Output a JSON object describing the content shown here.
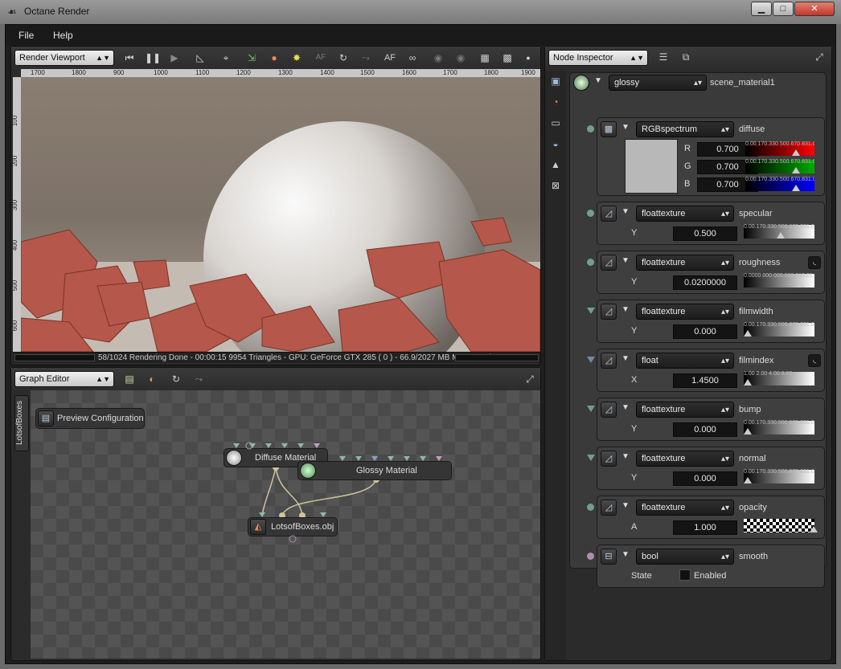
{
  "window": {
    "title": "Octane Render",
    "minimize": "▁",
    "maximize": "□",
    "close": "✕"
  },
  "menu": {
    "file": "File",
    "help": "Help"
  },
  "viewport": {
    "mode": "Render Viewport",
    "ruler_top": [
      "1700",
      "1800",
      "900",
      "1000",
      "1100",
      "1200",
      "1300",
      "1400",
      "1500",
      "1600",
      "1700",
      "1800",
      "1900"
    ],
    "ruler_left": [
      "100",
      "200",
      "300",
      "400",
      "500",
      "600"
    ],
    "status": "58/1024 Rendering Done - 00:00:15 9954 Triangles - GPU: GeForce GTX 285 ( 0 ) - 66.9/2027 MB Mem Used",
    "tool_af": "AF",
    "tool_af2": "AF"
  },
  "graph": {
    "mode": "Graph Editor",
    "side_tab": "LotsofBoxes",
    "nodes": {
      "preview": "Preview Configuration",
      "diffuse": "Diffuse Material",
      "glossy": "Glossy Material",
      "mesh": "LotsofBoxes.obj"
    }
  },
  "inspector": {
    "mode": "Node Inspector",
    "root": {
      "type": "glossy",
      "name": "scene_material1"
    },
    "diffuse": {
      "type": "RGBspectrum",
      "label": "diffuse",
      "r_label": "R",
      "g_label": "G",
      "b_label": "B",
      "r": "0.700",
      "g": "0.700",
      "b": "0.700",
      "ticks": "0.00.170.330.500.670.831.00",
      "swatch": "#b8b8b8"
    },
    "specular": {
      "type": "floattexture",
      "label": "specular",
      "ch": "Y",
      "value": "0.500",
      "ticks": "0.00.170.330.500.670.831.00"
    },
    "roughness": {
      "type": "floattexture",
      "label": "roughness",
      "ch": "Y",
      "value": "0.0200000",
      "ticks": "0.0000.000.000.000.010.01"
    },
    "filmwidth": {
      "type": "floattexture",
      "label": "filmwidth",
      "ch": "Y",
      "value": "0.000",
      "ticks": "0.00.170.330.500.670.831.00"
    },
    "filmindex": {
      "type": "float",
      "label": "filmindex",
      "ch": "X",
      "value": "1.4500",
      "ticks": "1.00    2.00     4.00   8.00"
    },
    "bump": {
      "type": "floattexture",
      "label": "bump",
      "ch": "Y",
      "value": "0.000",
      "ticks": "0.00.170.330.500.670.831.00"
    },
    "normal": {
      "type": "floattexture",
      "label": "normal",
      "ch": "Y",
      "value": "0.000",
      "ticks": "0.00.170.330.500.670.831.00"
    },
    "opacity": {
      "type": "floattexture",
      "label": "opacity",
      "ch": "A",
      "value": "1.000"
    },
    "smooth": {
      "type": "bool",
      "label": "smooth",
      "ch": "State",
      "checkbox_label": "Enabled"
    }
  },
  "colors": {
    "accent_red": "#c0564a",
    "pin_teal": "#6fa08c",
    "pin_blue": "#6d8aa8",
    "pin_pink": "#b48bb0"
  }
}
